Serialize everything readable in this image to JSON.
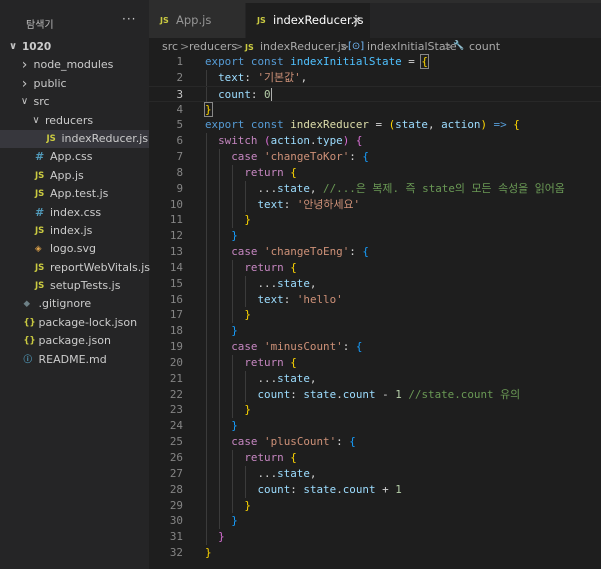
{
  "explorer": {
    "title": "탐색기",
    "more": "···",
    "tree": [
      {
        "label": "1020",
        "depth": 0,
        "chevron": "v",
        "icon": "",
        "iconType": "",
        "root": true
      },
      {
        "label": "node_modules",
        "depth": 1,
        "chevron": ">",
        "icon": "",
        "iconType": ""
      },
      {
        "label": "public",
        "depth": 1,
        "chevron": ">",
        "icon": "",
        "iconType": ""
      },
      {
        "label": "src",
        "depth": 1,
        "chevron": "v",
        "icon": "",
        "iconType": ""
      },
      {
        "label": "reducers",
        "depth": 2,
        "chevron": "v",
        "icon": "",
        "iconType": ""
      },
      {
        "label": "indexReducer.js",
        "depth": 3,
        "chevron": "",
        "icon": "JS",
        "iconType": "js",
        "selected": true
      },
      {
        "label": "App.css",
        "depth": 2,
        "chevron": "",
        "icon": "#",
        "iconType": "css"
      },
      {
        "label": "App.js",
        "depth": 2,
        "chevron": "",
        "icon": "JS",
        "iconType": "js"
      },
      {
        "label": "App.test.js",
        "depth": 2,
        "chevron": "",
        "icon": "JS",
        "iconType": "js"
      },
      {
        "label": "index.css",
        "depth": 2,
        "chevron": "",
        "icon": "#",
        "iconType": "css"
      },
      {
        "label": "index.js",
        "depth": 2,
        "chevron": "",
        "icon": "JS",
        "iconType": "js"
      },
      {
        "label": "logo.svg",
        "depth": 2,
        "chevron": "",
        "icon": "◈",
        "iconType": "svg"
      },
      {
        "label": "reportWebVitals.js",
        "depth": 2,
        "chevron": "",
        "icon": "JS",
        "iconType": "js"
      },
      {
        "label": "setupTests.js",
        "depth": 2,
        "chevron": "",
        "icon": "JS",
        "iconType": "js"
      },
      {
        "label": ".gitignore",
        "depth": 1,
        "chevron": "",
        "icon": "◆",
        "iconType": "git"
      },
      {
        "label": "package-lock.json",
        "depth": 1,
        "chevron": "",
        "icon": "{}",
        "iconType": "json"
      },
      {
        "label": "package.json",
        "depth": 1,
        "chevron": "",
        "icon": "{}",
        "iconType": "json"
      },
      {
        "label": "README.md",
        "depth": 1,
        "chevron": "",
        "icon": "ⓘ",
        "iconType": "info"
      }
    ]
  },
  "tabs": [
    {
      "label": "App.js",
      "icon": "JS",
      "active": false
    },
    {
      "label": "indexReducer.js",
      "icon": "JS",
      "active": true,
      "close": "✕"
    }
  ],
  "breadcrumb": {
    "seg1": "src",
    "seg2": "reducers",
    "seg3_icon": "JS",
    "seg3": "indexReducer.js",
    "seg4_icon": "[⊙]",
    "seg4": "indexInitialState",
    "seg5_icon": "🔧",
    "seg5": "count",
    "sep": ">"
  },
  "editor": {
    "current_line": 3,
    "lines": [
      [
        [
          "kw",
          "export "
        ],
        [
          "kw",
          "const "
        ],
        [
          "cst",
          "indexInitialState"
        ],
        [
          "pun",
          " = "
        ],
        [
          "br1",
          "{"
        ]
      ],
      [
        [
          "pun",
          "  "
        ],
        [
          "var",
          "text"
        ],
        [
          "pun",
          ": "
        ],
        [
          "str",
          "'기본값'"
        ],
        [
          "pun",
          ","
        ]
      ],
      [
        [
          "pun",
          "  "
        ],
        [
          "var",
          "count"
        ],
        [
          "pun",
          ": "
        ],
        [
          "num",
          "0"
        ]
      ],
      [
        [
          "br1",
          "}"
        ]
      ],
      [
        [
          "kw",
          "export "
        ],
        [
          "kw",
          "const "
        ],
        [
          "fn",
          "indexReducer"
        ],
        [
          "pun",
          " = "
        ],
        [
          "br1",
          "("
        ],
        [
          "var",
          "state"
        ],
        [
          "pun",
          ", "
        ],
        [
          "var",
          "action"
        ],
        [
          "br1",
          ")"
        ],
        [
          "kw",
          " => "
        ],
        [
          "br1",
          "{"
        ]
      ],
      [
        [
          "pun",
          "  "
        ],
        [
          "ctl",
          "switch "
        ],
        [
          "br2",
          "("
        ],
        [
          "var",
          "action"
        ],
        [
          "pun",
          "."
        ],
        [
          "var",
          "type"
        ],
        [
          "br2",
          ")"
        ],
        [
          "pun",
          " "
        ],
        [
          "br2",
          "{"
        ]
      ],
      [
        [
          "pun",
          "    "
        ],
        [
          "ctl",
          "case "
        ],
        [
          "str",
          "'changeToKor'"
        ],
        [
          "pun",
          ": "
        ],
        [
          "br3",
          "{"
        ]
      ],
      [
        [
          "pun",
          "      "
        ],
        [
          "ctl",
          "return "
        ],
        [
          "br1",
          "{"
        ]
      ],
      [
        [
          "pun",
          "        ..."
        ],
        [
          "var",
          "state"
        ],
        [
          "pun",
          ", "
        ],
        [
          "cmt",
          "//...은 복제. 즉 state의 모든 속성을 읽어옴"
        ]
      ],
      [
        [
          "pun",
          "        "
        ],
        [
          "var",
          "text"
        ],
        [
          "pun",
          ": "
        ],
        [
          "str",
          "'안녕하세요'"
        ]
      ],
      [
        [
          "pun",
          "      "
        ],
        [
          "br1",
          "}"
        ]
      ],
      [
        [
          "pun",
          "    "
        ],
        [
          "br3",
          "}"
        ]
      ],
      [
        [
          "pun",
          "    "
        ],
        [
          "ctl",
          "case "
        ],
        [
          "str",
          "'changeToEng'"
        ],
        [
          "pun",
          ": "
        ],
        [
          "br3",
          "{"
        ]
      ],
      [
        [
          "pun",
          "      "
        ],
        [
          "ctl",
          "return "
        ],
        [
          "br1",
          "{"
        ]
      ],
      [
        [
          "pun",
          "        ..."
        ],
        [
          "var",
          "state"
        ],
        [
          "pun",
          ","
        ]
      ],
      [
        [
          "pun",
          "        "
        ],
        [
          "var",
          "text"
        ],
        [
          "pun",
          ": "
        ],
        [
          "str",
          "'hello'"
        ]
      ],
      [
        [
          "pun",
          "      "
        ],
        [
          "br1",
          "}"
        ]
      ],
      [
        [
          "pun",
          "    "
        ],
        [
          "br3",
          "}"
        ]
      ],
      [
        [
          "pun",
          "    "
        ],
        [
          "ctl",
          "case "
        ],
        [
          "str",
          "'minusCount'"
        ],
        [
          "pun",
          ": "
        ],
        [
          "br3",
          "{"
        ]
      ],
      [
        [
          "pun",
          "      "
        ],
        [
          "ctl",
          "return "
        ],
        [
          "br1",
          "{"
        ]
      ],
      [
        [
          "pun",
          "        ..."
        ],
        [
          "var",
          "state"
        ],
        [
          "pun",
          ","
        ]
      ],
      [
        [
          "pun",
          "        "
        ],
        [
          "var",
          "count"
        ],
        [
          "pun",
          ": "
        ],
        [
          "var",
          "state"
        ],
        [
          "pun",
          "."
        ],
        [
          "var",
          "count"
        ],
        [
          "pun",
          " - "
        ],
        [
          "num",
          "1"
        ],
        [
          "pun",
          " "
        ],
        [
          "cmt",
          "//state.count 유의"
        ]
      ],
      [
        [
          "pun",
          "      "
        ],
        [
          "br1",
          "}"
        ]
      ],
      [
        [
          "pun",
          "    "
        ],
        [
          "br3",
          "}"
        ]
      ],
      [
        [
          "pun",
          "    "
        ],
        [
          "ctl",
          "case "
        ],
        [
          "str",
          "'plusCount'"
        ],
        [
          "pun",
          ": "
        ],
        [
          "br3",
          "{"
        ]
      ],
      [
        [
          "pun",
          "      "
        ],
        [
          "ctl",
          "return "
        ],
        [
          "br1",
          "{"
        ]
      ],
      [
        [
          "pun",
          "        ..."
        ],
        [
          "var",
          "state"
        ],
        [
          "pun",
          ","
        ]
      ],
      [
        [
          "pun",
          "        "
        ],
        [
          "var",
          "count"
        ],
        [
          "pun",
          ": "
        ],
        [
          "var",
          "state"
        ],
        [
          "pun",
          "."
        ],
        [
          "var",
          "count"
        ],
        [
          "pun",
          " + "
        ],
        [
          "num",
          "1"
        ]
      ],
      [
        [
          "pun",
          "      "
        ],
        [
          "br1",
          "}"
        ]
      ],
      [
        [
          "pun",
          "    "
        ],
        [
          "br3",
          "}"
        ]
      ],
      [
        [
          "pun",
          "  "
        ],
        [
          "br2",
          "}"
        ]
      ],
      [
        [
          "br1",
          "}"
        ]
      ]
    ]
  }
}
